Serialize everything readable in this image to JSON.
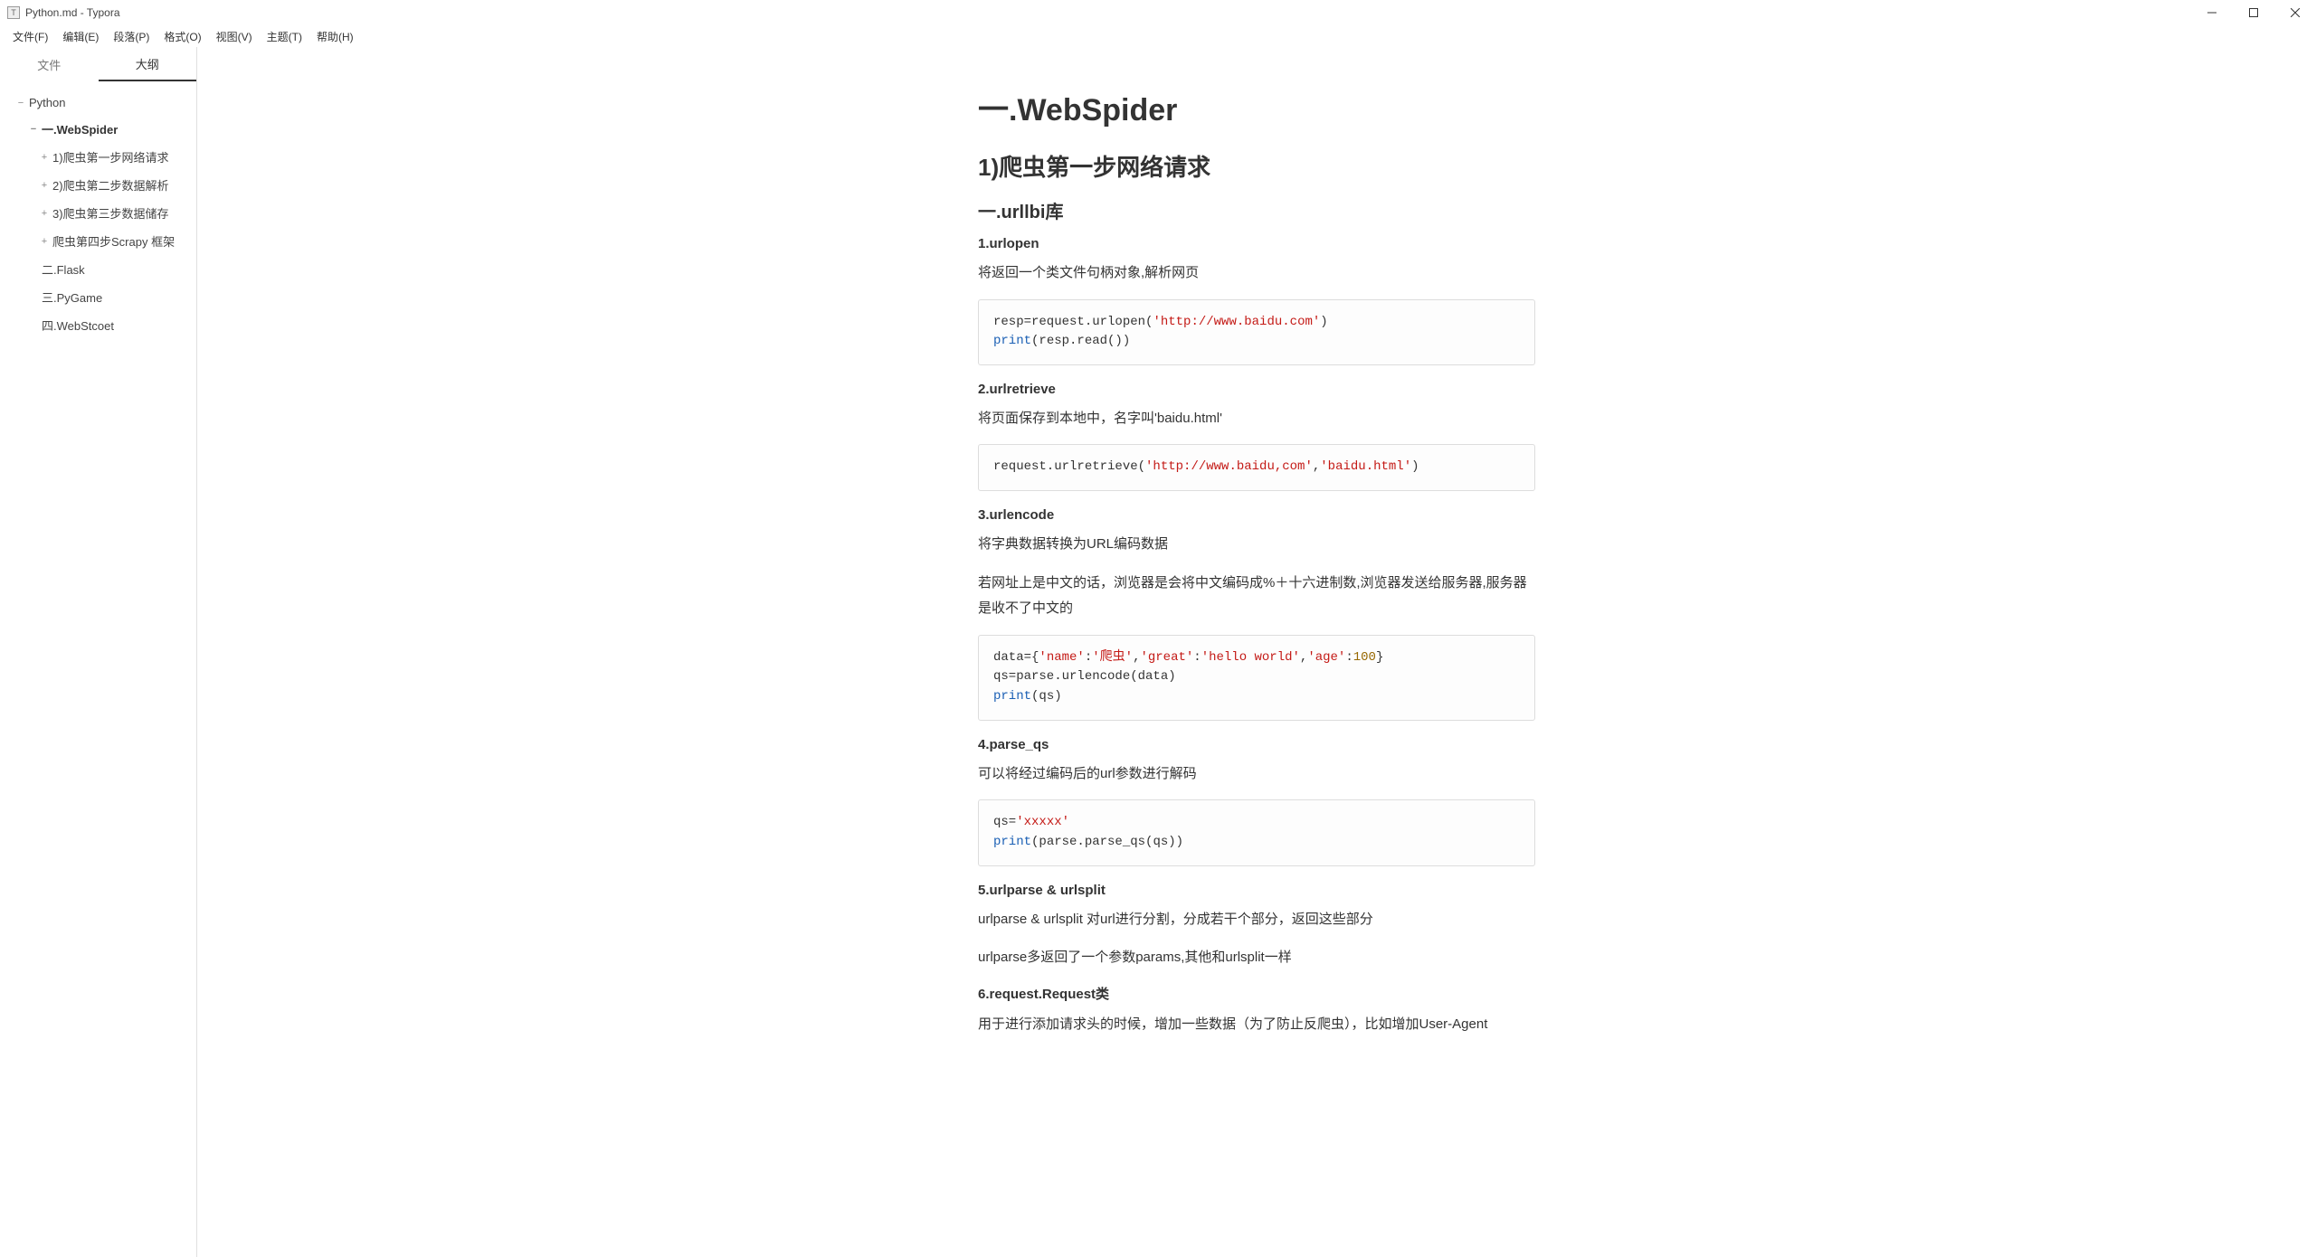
{
  "window": {
    "app_icon_label": "T",
    "title": "Python.md - Typora"
  },
  "menubar": {
    "items": [
      {
        "label": "文件(F)"
      },
      {
        "label": "编辑(E)"
      },
      {
        "label": "段落(P)"
      },
      {
        "label": "格式(O)"
      },
      {
        "label": "视图(V)"
      },
      {
        "label": "主题(T)"
      },
      {
        "label": "帮助(H)"
      }
    ]
  },
  "sidebar": {
    "tabs": {
      "files": "文件",
      "outline": "大纲"
    },
    "outline": [
      {
        "level": 1,
        "icon": "−",
        "label": "Python"
      },
      {
        "level": 2,
        "icon": "−",
        "label": "一.WebSpider",
        "bold": true
      },
      {
        "level": 3,
        "icon": "+",
        "label": "1)爬虫第一步网络请求"
      },
      {
        "level": 3,
        "icon": "+",
        "label": "2)爬虫第二步数据解析"
      },
      {
        "level": 3,
        "icon": "+",
        "label": "3)爬虫第三步数据储存"
      },
      {
        "level": 3,
        "icon": "+",
        "label": "爬虫第四步Scrapy 框架"
      },
      {
        "level": 2,
        "icon": "",
        "label": "二.Flask"
      },
      {
        "level": 2,
        "icon": "",
        "label": "三.PyGame"
      },
      {
        "level": 2,
        "icon": "",
        "label": "四.WebStcoet"
      }
    ]
  },
  "document": {
    "h1": "一.WebSpider",
    "h2": "1)爬虫第一步网络请求",
    "h3": "一.urllbi库",
    "sections": {
      "s1": {
        "title": "1.urlopen",
        "p1": "将返回一个类文件句柄对象,解析网页",
        "code": {
          "l1a": "resp=request.urlopen(",
          "l1b": "'http://www.baidu.com'",
          "l1c": ")",
          "l2a": "print",
          "l2b": "(resp.read())"
        }
      },
      "s2": {
        "title": "2.urlretrieve",
        "p1": "将页面保存到本地中，名字叫'baidu.html'",
        "code": {
          "l1a": "request.urlretrieve(",
          "l1b": "'http://www.baidu,com'",
          "l1c": ",",
          "l1d": "'baidu.html'",
          "l1e": ")"
        }
      },
      "s3": {
        "title": "3.urlencode",
        "p1": "将字典数据转换为URL编码数据",
        "p2": "若网址上是中文的话，浏览器是会将中文编码成%＋十六进制数,浏览器发送给服务器,服务器是收不了中文的",
        "code": {
          "l1a": "data={",
          "l1b": "'name'",
          "l1c": ":",
          "l1d": "'爬虫'",
          "l1e": ",",
          "l1f": "'great'",
          "l1g": ":",
          "l1h": "'hello world'",
          "l1i": ",",
          "l1j": "'age'",
          "l1k": ":",
          "l1l": "100",
          "l1m": "}",
          "l2": "qs=parse.urlencode(data)",
          "l3a": "print",
          "l3b": "(qs)"
        }
      },
      "s4": {
        "title": "4.parse_qs",
        "p1": "可以将经过编码后的url参数进行解码",
        "code": {
          "l1a": "qs=",
          "l1b": "'xxxxx'",
          "l2a": "print",
          "l2b": "(parse.parse_qs(qs))"
        }
      },
      "s5": {
        "title": "5.urlparse & urlsplit",
        "p1": "urlparse & urlsplit 对url进行分割，分成若干个部分，返回这些部分",
        "p2": "urlparse多返回了一个参数params,其他和urlsplit一样"
      },
      "s6": {
        "title": "6.request.Request类",
        "p1": "用于进行添加请求头的时候，增加一些数据（为了防止反爬虫），比如增加User-Agent"
      }
    }
  }
}
